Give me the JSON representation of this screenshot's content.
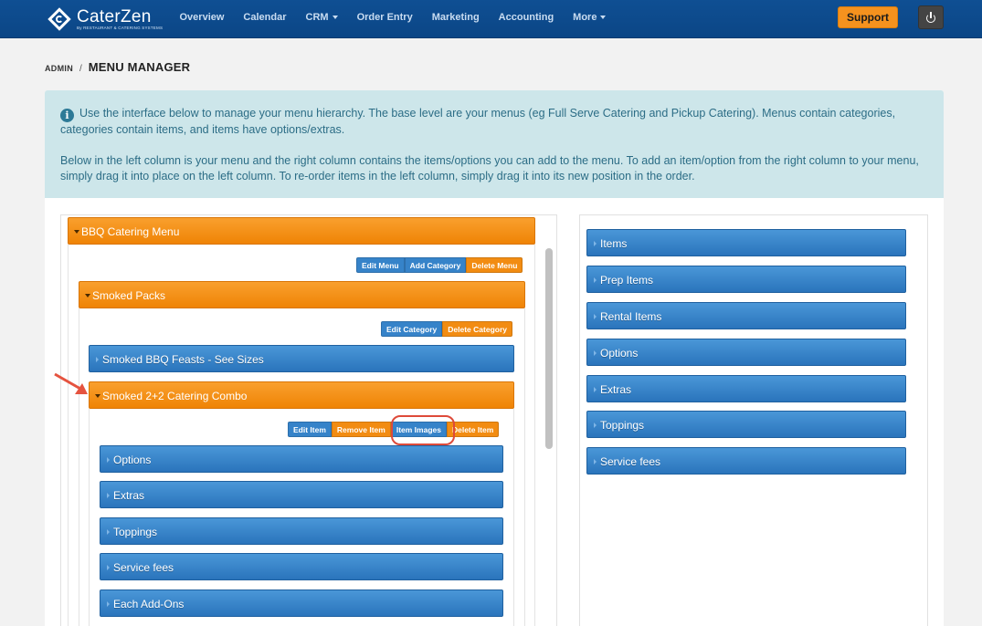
{
  "brand": {
    "name": "CaterZen",
    "tagline": "By RESTAURANT & CATERING SYSTEMS"
  },
  "nav": {
    "items": [
      {
        "label": "Overview"
      },
      {
        "label": "Calendar"
      },
      {
        "label": "CRM",
        "dropdown": true
      },
      {
        "label": "Order Entry"
      },
      {
        "label": "Marketing"
      },
      {
        "label": "Accounting"
      },
      {
        "label": "More",
        "dropdown": true
      }
    ],
    "support_label": "Support",
    "power_icon": "power-icon"
  },
  "breadcrumb": {
    "parent": "ADMIN",
    "separator": "/",
    "current": "MENU MANAGER"
  },
  "info": {
    "icon": "info-icon",
    "paragraph1": "Use the interface below to manage your menu hierarchy. The base level are your menus (eg Full Serve Catering and Pickup Catering). Menus contain categories, categories contain items, and items have options/extras.",
    "paragraph2": "Below in the left column is your menu and the right column contains the items/options you can add to the menu. To add an item/option from the right column to your menu, simply drag it into place on the left column. To re-order items in the left column, simply drag it into its new position in the order."
  },
  "menu": {
    "title": "BBQ Catering Menu",
    "buttons": {
      "edit": "Edit Menu",
      "add_category": "Add Category",
      "delete": "Delete Menu"
    },
    "category": {
      "title": "Smoked Packs",
      "buttons": {
        "edit": "Edit Category",
        "delete": "Delete Category"
      },
      "items": [
        {
          "title": "Smoked BBQ Feasts - See Sizes",
          "expanded": false
        },
        {
          "title": "Smoked 2+2 Catering Combo",
          "expanded": true
        }
      ],
      "item_buttons": {
        "edit": "Edit Item",
        "remove": "Remove Item",
        "images": "Item Images",
        "delete": "Delete Item"
      },
      "groups": [
        "Options",
        "Extras",
        "Toppings",
        "Service fees",
        "Each Add-Ons"
      ]
    }
  },
  "library": [
    "Items",
    "Prep Items",
    "Rental Items",
    "Options",
    "Extras",
    "Toppings",
    "Service fees"
  ],
  "colors": {
    "nav_bg": "#0f4f93",
    "orange": "#f28c12",
    "blue": "#2a74bc",
    "info_bg": "#cde6ea",
    "highlight": "#de4a3a"
  }
}
